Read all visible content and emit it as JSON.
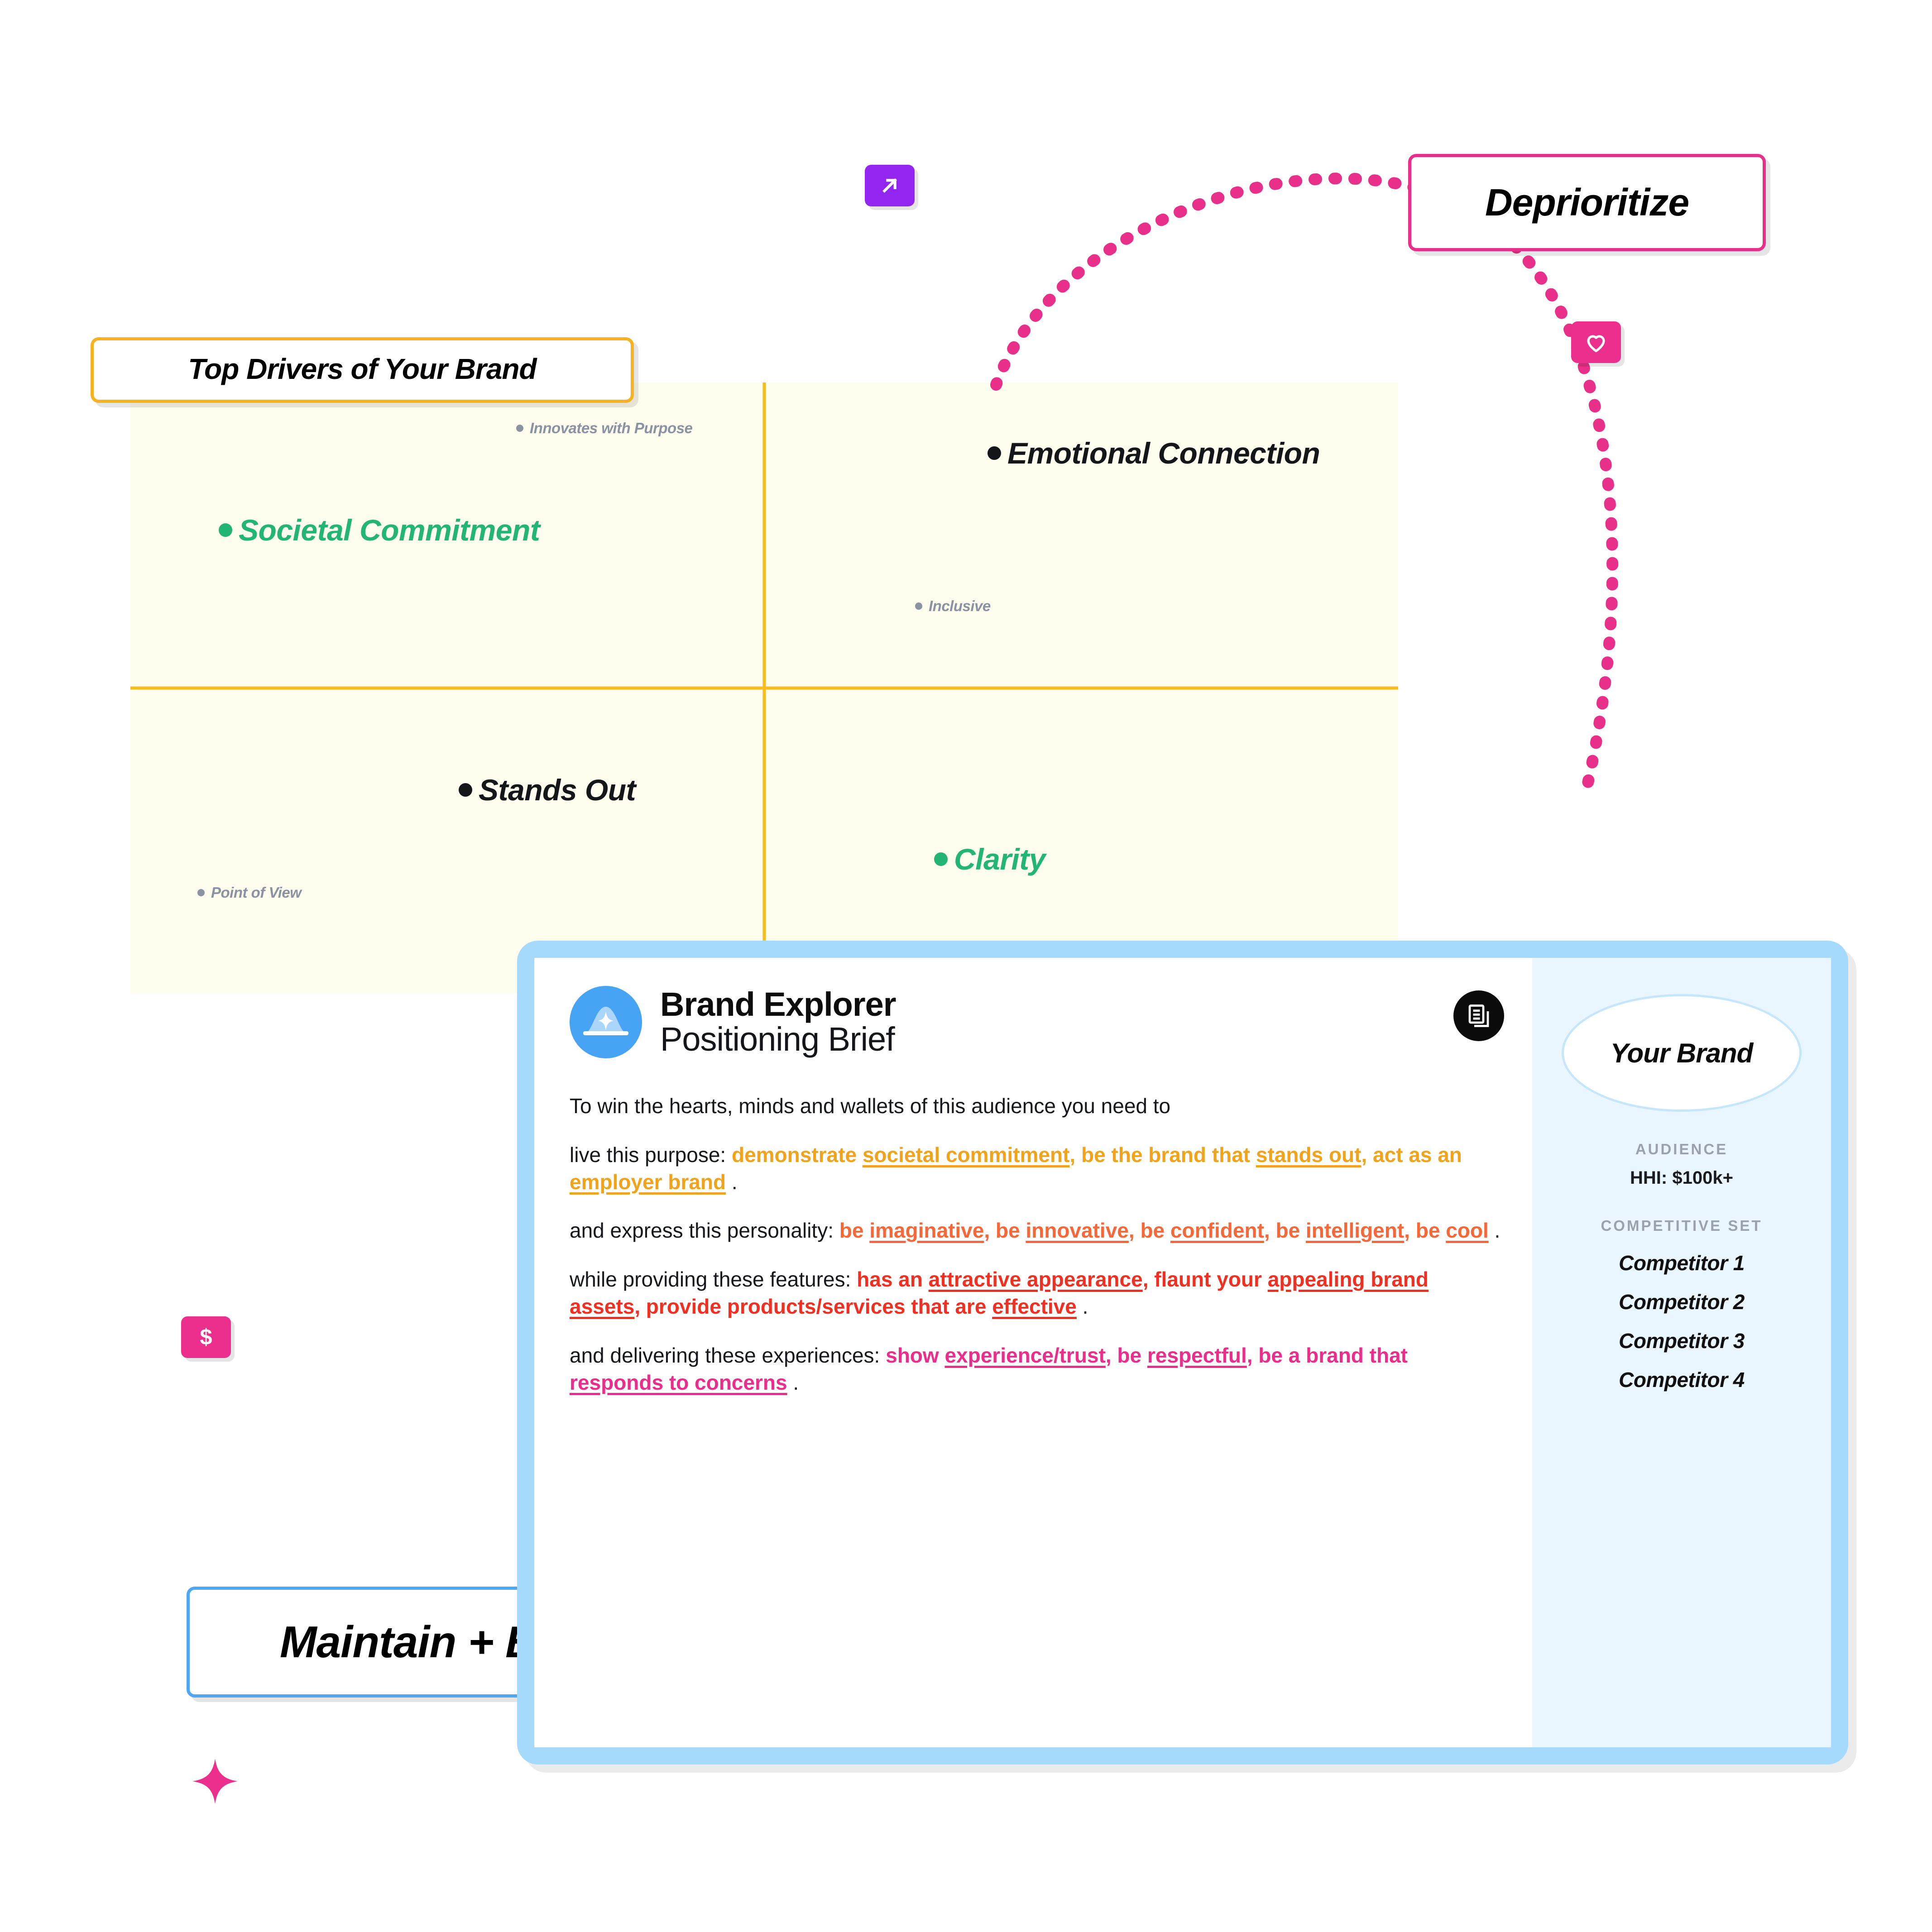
{
  "callouts": {
    "top_drivers": "Top Drivers of Your Brand",
    "deprioritize": "Deprioritize",
    "maintain_build": "Maintain + Build"
  },
  "quadrant": {
    "drivers": [
      {
        "label": "Innovates with Purpose",
        "size": "small",
        "color": "grey"
      },
      {
        "label": "Societal Commitment",
        "size": "big",
        "color": "green"
      },
      {
        "label": "Emotional Connection",
        "size": "big",
        "color": "black"
      },
      {
        "label": "Inclusive",
        "size": "small",
        "color": "grey"
      },
      {
        "label": "Stands Out",
        "size": "big",
        "color": "black"
      },
      {
        "label": "Point of View",
        "size": "small",
        "color": "grey"
      },
      {
        "label": "Clarity",
        "size": "big",
        "color": "green"
      }
    ]
  },
  "card": {
    "brand_title": "Brand Explorer",
    "brand_subtitle": "Positioning Brief",
    "intro": "To win the hearts, minds and wallets of this audience you need to",
    "paragraphs": [
      {
        "lead": "live this purpose:",
        "color": "y",
        "segments": [
          {
            "plain": "demonstrate ",
            "underline": "societal commitment"
          },
          {
            "sep": ", ",
            "plain": "be the brand that ",
            "underline": "stands out"
          },
          {
            "sep": ", ",
            "plain": "act as an",
            "underline": " employer brand"
          }
        ],
        "end": " ."
      },
      {
        "lead": "and express this personality:",
        "color": "o",
        "segments": [
          {
            "plain": "be ",
            "underline": "imaginative"
          },
          {
            "sep": ", ",
            "plain": "be ",
            "underline": "innovative"
          },
          {
            "sep": ", ",
            "plain": "be ",
            "underline": "confident"
          },
          {
            "sep": ", ",
            "plain": "be ",
            "underline": "intelligent"
          },
          {
            "sep": ", ",
            "plain": "be ",
            "underline": "cool"
          }
        ],
        "end": " ."
      },
      {
        "lead": "while providing these features:",
        "color": "r",
        "segments": [
          {
            "plain": "has an ",
            "underline": "attractive appearance"
          },
          {
            "sep": ", ",
            "plain": "flaunt your ",
            "underline": "appealing brand assets"
          },
          {
            "sep": ", ",
            "plain": "provide products/services that are ",
            "underline": "effective"
          }
        ],
        "end": " ."
      },
      {
        "lead": "and delivering these experiences:",
        "color": "p",
        "segments": [
          {
            "plain": "show ",
            "underline": "experience/trust"
          },
          {
            "sep": ", ",
            "plain": "be ",
            "underline": "respectful"
          },
          {
            "sep": ", ",
            "plain": "be a brand that",
            "underline": " responds to concerns"
          }
        ],
        "end": " ."
      }
    ],
    "sidebar": {
      "brand_oval_label": "Your Brand",
      "audience_heading": "AUDIENCE",
      "audience_value": "HHI: $100k+",
      "competitive_heading": "COMPETITIVE SET",
      "competitors": [
        "Competitor 1",
        "Competitor 2",
        "Competitor 3",
        "Competitor 4"
      ]
    }
  },
  "icons": {
    "arrow_top": "arrow-up-right-icon",
    "heart": "heart-icon",
    "dollar": "dollar-icon",
    "arrow_bottom": "arrow-up-right-icon",
    "document": "document-copy-icon",
    "sparkle_card": "sparkle-icon",
    "sparkle_bottom": "sparkle-icon"
  },
  "colors": {
    "quadrant_bg": "#fefdee",
    "quadrant_line": "#f5bd1e",
    "green": "#22b573",
    "grey": "#8b93a3",
    "pink": "#ec2e8c",
    "purple": "#9225f0",
    "card_blue": "#a6dafd",
    "yellow_border": "#f5b322",
    "blue_border": "#4ea6f5"
  }
}
